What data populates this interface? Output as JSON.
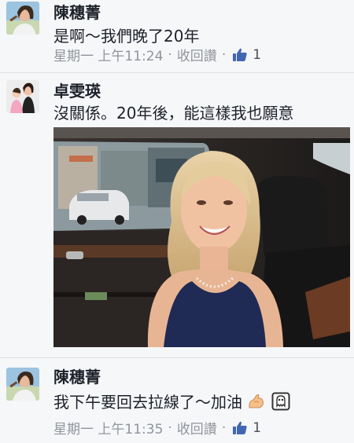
{
  "comments": [
    {
      "author": "陳穗菁",
      "text": "是啊～我們晚了20年",
      "time": "星期一 上午11:24",
      "action": "收回讚",
      "likes": "1"
    },
    {
      "author": "卓雯瑛",
      "text": "沒關係。20年後，能這樣我也願意"
    },
    {
      "author": "陳穗菁",
      "text": "我下午要回去拉線了～加油",
      "time": "星期一 上午11:35",
      "action": "收回讚",
      "likes": "1"
    }
  ],
  "meta_separator": "·",
  "colors": {
    "background": "#f6f7f9",
    "meta_text": "#90949c",
    "like_blue": "#4267b2"
  },
  "icons": {
    "like": "thumbs-up-icon",
    "flex": "flexed-biceps-emoji",
    "ghost": "ghost-face-emoji"
  }
}
